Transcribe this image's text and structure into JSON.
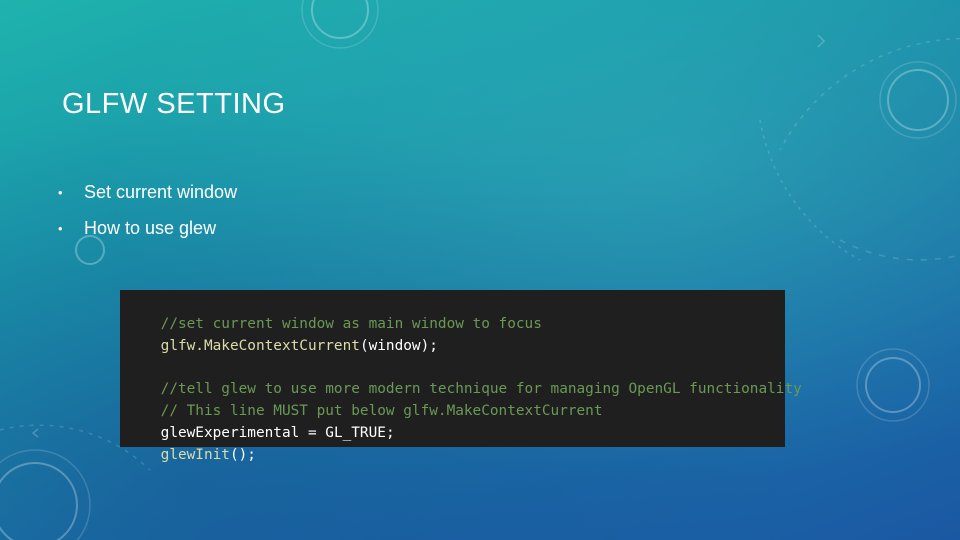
{
  "slide": {
    "title": "GLFW SETTING",
    "bullets": [
      "Set current window",
      "How to use glew"
    ],
    "bullet_symbol": "•"
  },
  "code": {
    "line1_comment": "//set current window as main window to focus",
    "line2_func": "glfw.MakeContextCurrent",
    "line2_args": "(window);",
    "line4_comment": "//tell glew to use more modern technique for managing OpenGL functionality",
    "line5_comment": "// This line MUST put below glfw.MakeContextCurrent",
    "line6_var": "glewExperimental",
    "line6_op": " = ",
    "line6_value": "GL_TRUE",
    "line6_end": ";",
    "line7_func": "glewInit",
    "line7_end": "();"
  },
  "colors": {
    "comment": "#6a9955",
    "function": "#dcdcaa",
    "code_background": "#1f1f1f",
    "text": "#ffffff"
  }
}
